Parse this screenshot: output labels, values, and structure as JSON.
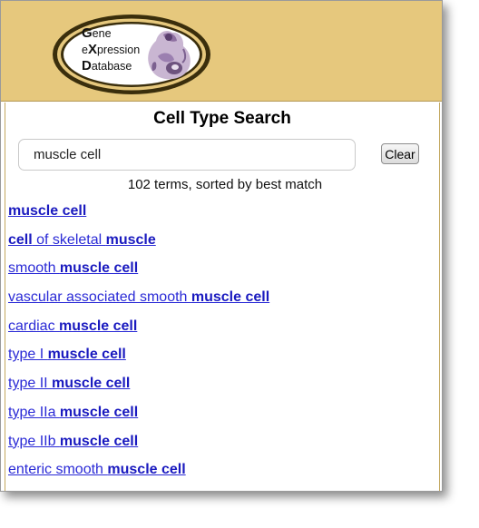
{
  "logo": {
    "line1_initial": "G",
    "line1_rest": "ene",
    "line2_pre": "e",
    "line2_initial": "X",
    "line2_rest": "pression",
    "line3_initial": "D",
    "line3_rest": "atabase"
  },
  "page": {
    "title": "Cell Type Search"
  },
  "search": {
    "value": "muscle cell",
    "clear_label": "Clear"
  },
  "summary": "102 terms, sorted by best match",
  "results": [
    {
      "pre": "",
      "b1": "muscle cell",
      "mid": "",
      "b2": ""
    },
    {
      "pre": "",
      "b1": "cell",
      "mid": " of skeletal ",
      "b2": "muscle"
    },
    {
      "pre": "smooth ",
      "b1": "muscle cell",
      "mid": "",
      "b2": ""
    },
    {
      "pre": "vascular associated smooth ",
      "b1": "muscle cell",
      "mid": "",
      "b2": ""
    },
    {
      "pre": "cardiac ",
      "b1": "muscle cell",
      "mid": "",
      "b2": ""
    },
    {
      "pre": "type I ",
      "b1": "muscle cell",
      "mid": "",
      "b2": ""
    },
    {
      "pre": "type II ",
      "b1": "muscle cell",
      "mid": "",
      "b2": ""
    },
    {
      "pre": "type IIa ",
      "b1": "muscle cell",
      "mid": "",
      "b2": ""
    },
    {
      "pre": "type IIb ",
      "b1": "muscle cell",
      "mid": "",
      "b2": ""
    },
    {
      "pre": "enteric smooth ",
      "b1": "muscle cell",
      "mid": "",
      "b2": ""
    }
  ],
  "colors": {
    "banner": "#e6c87d",
    "link": "#2a2ad6",
    "logo_ring": "#3a2e0c"
  }
}
